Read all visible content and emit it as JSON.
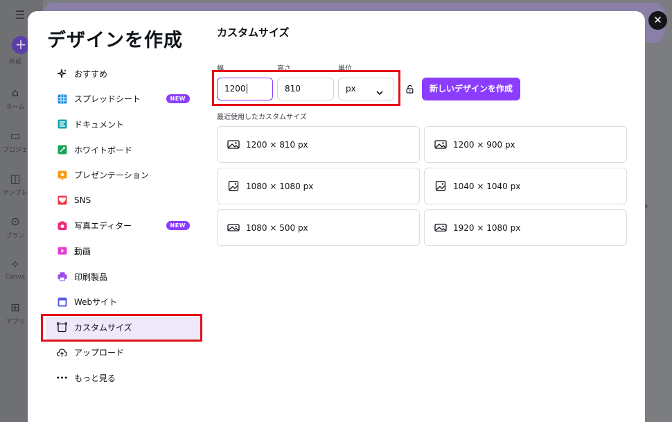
{
  "background": {
    "rail": [
      {
        "label": "作成",
        "icon": "plus-icon"
      },
      {
        "label": "ホーム",
        "icon": "home-icon"
      },
      {
        "label": "プロジェ",
        "icon": "folder-icon"
      },
      {
        "label": "テンプレ",
        "icon": "template-icon"
      },
      {
        "label": "ブラン",
        "icon": "brand-icon"
      },
      {
        "label": "Canva",
        "icon": "sparkle-icon"
      },
      {
        "label": "アプリ",
        "icon": "apps-icon"
      }
    ]
  },
  "modal": {
    "title": "デザインを作成",
    "categories": [
      {
        "label": "おすすめ",
        "icon": "sparkle-icon",
        "color": "#0e1318"
      },
      {
        "label": "スプレッドシート",
        "icon": "spreadsheet-icon",
        "color": "#1b8fe0",
        "badge": "NEW"
      },
      {
        "label": "ドキュメント",
        "icon": "document-icon",
        "color": "#13a3b5"
      },
      {
        "label": "ホワイトボード",
        "icon": "whiteboard-icon",
        "color": "#1aa55a"
      },
      {
        "label": "プレゼンテーション",
        "icon": "presentation-icon",
        "color": "#f59d1b"
      },
      {
        "label": "SNS",
        "icon": "heart-icon",
        "color": "#ef3b4b"
      },
      {
        "label": "写真エディター",
        "icon": "camera-icon",
        "color": "#ec2c7d",
        "badge": "NEW"
      },
      {
        "label": "動画",
        "icon": "video-icon",
        "color": "#e63fd0"
      },
      {
        "label": "印刷製品",
        "icon": "printer-icon",
        "color": "#9a4ee6"
      },
      {
        "label": "Webサイト",
        "icon": "website-icon",
        "color": "#5a5fe0"
      },
      {
        "label": "カスタムサイズ",
        "icon": "custom-size-icon",
        "color": "#0e1318",
        "active": true
      },
      {
        "label": "アップロード",
        "icon": "upload-cloud-icon",
        "color": "#0e1318"
      },
      {
        "label": "もっと見る",
        "icon": "more-icon",
        "color": "#0e1318"
      }
    ],
    "custom": {
      "title": "カスタムサイズ",
      "width_label": "幅",
      "height_label": "高さ",
      "unit_label": "単位",
      "width_value": "1200",
      "height_value": "810",
      "unit_value": "px",
      "create_button": "新しいデザインを作成",
      "recent_label": "最近使用したカスタムサイズ",
      "recent": [
        {
          "label": "1200 × 810 px",
          "icon": "landscape-image-icon"
        },
        {
          "label": "1200 × 900 px",
          "icon": "landscape-image-icon"
        },
        {
          "label": "1080 × 1080 px",
          "icon": "square-image-icon"
        },
        {
          "label": "1040 × 1040 px",
          "icon": "square-image-icon"
        },
        {
          "label": "1080 × 500 px",
          "icon": "landscape-image-icon"
        },
        {
          "label": "1920 × 1080 px",
          "icon": "landscape-image-icon"
        }
      ]
    }
  },
  "colors": {
    "accent": "#8b3dff",
    "highlight": "#e20f17",
    "active_bg": "#eee8fa"
  }
}
